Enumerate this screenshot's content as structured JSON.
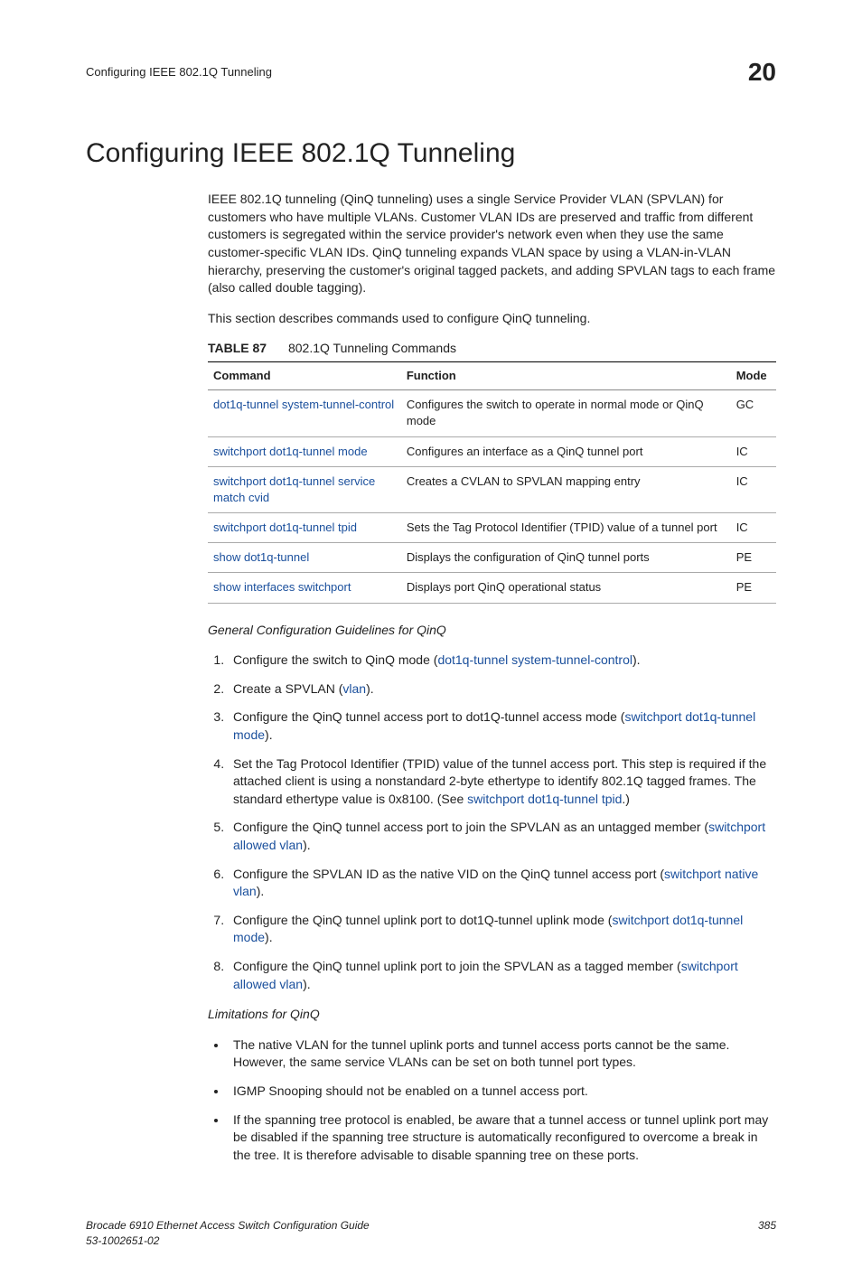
{
  "header": {
    "running": "Configuring IEEE 802.1Q Tunneling",
    "chapter": "20"
  },
  "title": "Configuring IEEE 802.1Q Tunneling",
  "intro1": "IEEE 802.1Q tunneling (QinQ tunneling) uses a single Service Provider VLAN (SPVLAN) for customers who have multiple VLANs. Customer VLAN IDs are preserved and traffic from different customers is segregated within the service provider's network even when they use the same customer-specific VLAN IDs. QinQ tunneling expands VLAN space by using a VLAN-in-VLAN hierarchy, preserving the customer's original tagged packets, and adding SPVLAN tags to each frame (also called double tagging).",
  "intro2": "This section describes commands used to configure QinQ tunneling.",
  "table": {
    "label": "TABLE 87",
    "caption": "802.1Q Tunneling Commands",
    "headers": {
      "c1": "Command",
      "c2": "Function",
      "c3": "Mode"
    },
    "rows": [
      {
        "cmd": "dot1q-tunnel system-tunnel-control",
        "fn": "Configures the switch to operate in normal mode or QinQ mode",
        "mode": "GC"
      },
      {
        "cmd": "switchport dot1q-tunnel mode",
        "fn": "Configures an interface as a QinQ tunnel port",
        "mode": "IC"
      },
      {
        "cmd": "switchport dot1q-tunnel service match cvid",
        "fn": "Creates a CVLAN to SPVLAN mapping entry",
        "mode": "IC"
      },
      {
        "cmd": "switchport dot1q-tunnel tpid",
        "fn": "Sets the Tag Protocol Identifier (TPID) value of a tunnel port",
        "mode": "IC"
      },
      {
        "cmd": "show dot1q-tunnel",
        "fn": "Displays the configuration of QinQ tunnel ports",
        "mode": "PE"
      },
      {
        "cmd": "show interfaces switchport",
        "fn": "Displays port QinQ operational status",
        "mode": "PE"
      }
    ]
  },
  "guide_head": "General Configuration Guidelines for QinQ",
  "steps": [
    {
      "a": "Configure the switch to QinQ mode (",
      "l": "dot1q-tunnel system-tunnel-control",
      "b": ")."
    },
    {
      "a": "Create a SPVLAN (",
      "l": "vlan",
      "b": ")."
    },
    {
      "a": "Configure the QinQ tunnel access port to dot1Q-tunnel access mode (",
      "l": "switchport dot1q-tunnel mode",
      "b": ")."
    },
    {
      "a": "Set the Tag Protocol Identifier (TPID) value of the tunnel access port. This step is required if the attached client is using a nonstandard 2-byte ethertype to identify 802.1Q tagged frames. The standard ethertype value is 0x8100. (See ",
      "l": "switchport dot1q-tunnel tpid",
      "b": ".)"
    },
    {
      "a": "Configure the QinQ tunnel access port to join the SPVLAN as an untagged member (",
      "l": "switchport allowed vlan",
      "b": ")."
    },
    {
      "a": "Configure the SPVLAN ID as the native VID on the QinQ tunnel access port (",
      "l": "switchport native vlan",
      "b": ")."
    },
    {
      "a": "Configure the QinQ tunnel uplink port to dot1Q-tunnel uplink mode (",
      "l": "switchport dot1q-tunnel mode",
      "b": ")."
    },
    {
      "a": "Configure the QinQ tunnel uplink port to join the SPVLAN as a tagged member (",
      "l": "switchport allowed vlan",
      "b": ")."
    }
  ],
  "limit_head": "Limitations for QinQ",
  "limits": [
    "The native VLAN for the tunnel uplink ports and tunnel access ports cannot be the same. However, the same service VLANs can be set on both tunnel port types.",
    "IGMP Snooping should not be enabled on a tunnel access port.",
    "If the spanning tree protocol is enabled, be aware that a tunnel access or tunnel uplink port may be disabled if the spanning tree structure is automatically reconfigured to overcome a break in the tree. It is therefore advisable to disable spanning tree on these ports."
  ],
  "footer": {
    "l1": "Brocade 6910 Ethernet Access Switch Configuration Guide",
    "l2": "53-1002651-02",
    "page": "385"
  }
}
